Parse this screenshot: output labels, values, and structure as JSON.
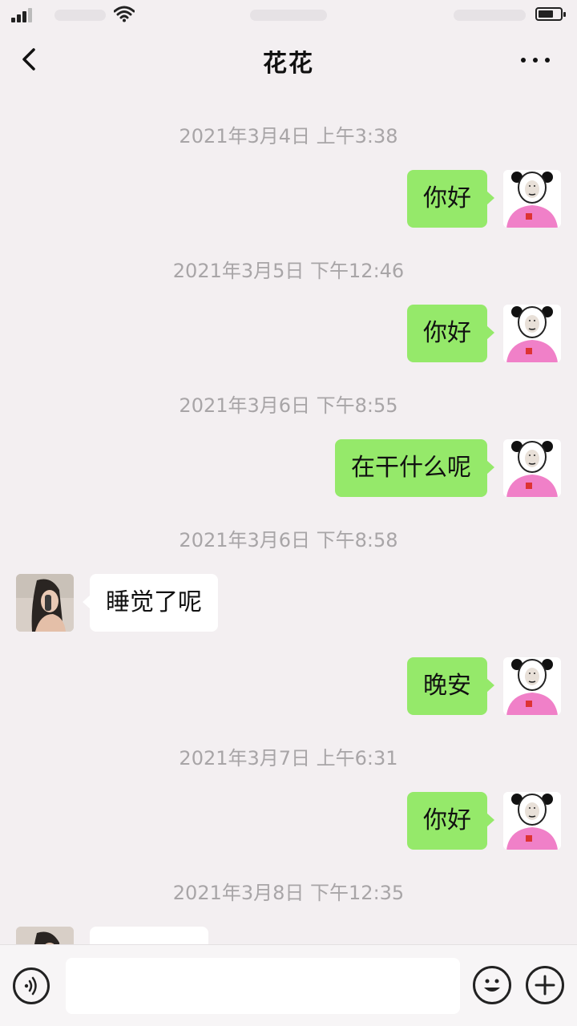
{
  "chat": {
    "title": "花花"
  },
  "messages": [
    {
      "timestamp": "2021年3月4日 上午3:38",
      "text": "你好"
    },
    {
      "timestamp": "2021年3月5日 下午12:46",
      "text": "你好"
    },
    {
      "timestamp": "2021年3月6日 下午8:55",
      "text": "在干什么呢"
    },
    {
      "timestamp": "2021年3月6日 下午8:58",
      "text": "睡觉了呢"
    },
    {
      "text": "晚安"
    },
    {
      "timestamp": "2021年3月7日 上午6:31",
      "text": "你好"
    },
    {
      "timestamp": "2021年3月8日 下午12:35"
    }
  ],
  "colors": {
    "background": "#f3eff1",
    "sent_bubble": "#95e96a",
    "received_bubble": "#ffffff",
    "timestamp_text": "#a8a5a7",
    "avatar_shirt": "#f080c8"
  },
  "icons": {
    "back": "back-chevron-icon",
    "more": "more-dots-icon",
    "voice": "voice-icon",
    "emoji": "emoji-icon",
    "plus": "plus-icon"
  }
}
